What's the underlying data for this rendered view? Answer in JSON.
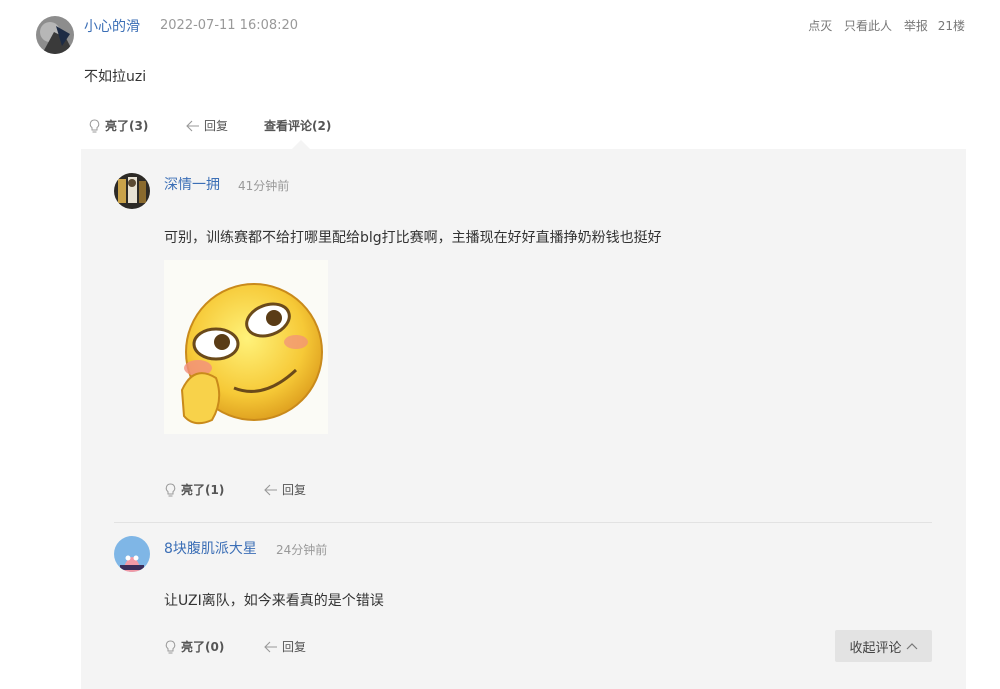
{
  "post": {
    "username": "小心的滑",
    "timestamp": "2022-07-11 16:08:20",
    "content": "不如拉uzi",
    "top_links": [
      "点灭",
      "只看此人",
      "举报"
    ],
    "floor": "21楼",
    "actions": {
      "light_label": "亮了(3)",
      "reply_label": "回复",
      "view_comments_label": "查看评论(2)"
    }
  },
  "comments": [
    {
      "username": "深情一拥",
      "time": "41分钟前",
      "content": "可别，训练赛都不给打哪里配给blg打比赛啊，主播现在好好直播挣奶粉钱也挺好",
      "image": "emoji-sticker",
      "light_label": "亮了(1)",
      "reply_label": "回复"
    },
    {
      "username": "8块腹肌派大星",
      "time": "24分钟前",
      "content": "让UZI离队，如今来看真的是个错误",
      "light_label": "亮了(0)",
      "reply_label": "回复"
    }
  ],
  "collapse_label": "收起评论",
  "icons": {
    "light": "lightbulb-icon",
    "reply": "reply-arrow-icon",
    "collapse": "chevron-up-icon"
  },
  "colors": {
    "username": "#3c6fb6",
    "meta": "#999999",
    "panel_bg": "#f4f4f4"
  }
}
